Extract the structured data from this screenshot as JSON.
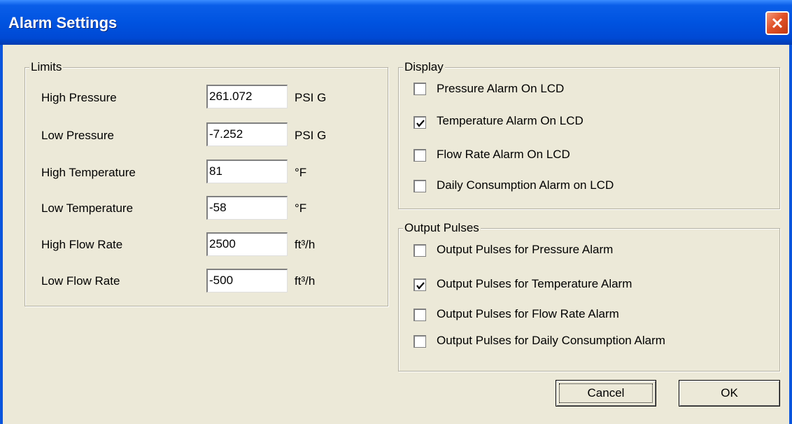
{
  "window": {
    "title": "Alarm Settings",
    "close_icon": "close-x-icon"
  },
  "limits": {
    "legend": "Limits",
    "rows": [
      {
        "label": "High Pressure",
        "value": "261.072",
        "unit": "PSI G"
      },
      {
        "label": "Low Pressure",
        "value": "-7.252",
        "unit": "PSI G"
      },
      {
        "label": "High Temperature",
        "value": "81",
        "unit": "°F"
      },
      {
        "label": "Low Temperature",
        "value": "-58",
        "unit": "°F"
      },
      {
        "label": "High Flow Rate",
        "value": "2500",
        "unit": "ft³/h"
      },
      {
        "label": "Low Flow Rate",
        "value": "-500",
        "unit": "ft³/h"
      }
    ]
  },
  "display": {
    "legend": "Display",
    "items": [
      {
        "label": "Pressure Alarm On LCD",
        "checked": false
      },
      {
        "label": "Temperature Alarm On LCD",
        "checked": true
      },
      {
        "label": "Flow Rate Alarm On LCD",
        "checked": false
      },
      {
        "label": "Daily Consumption Alarm on LCD",
        "checked": false
      }
    ]
  },
  "output_pulses": {
    "legend": "Output Pulses",
    "items": [
      {
        "label": "Output Pulses for Pressure Alarm",
        "checked": false
      },
      {
        "label": "Output Pulses for Temperature Alarm",
        "checked": true
      },
      {
        "label": "Output Pulses for Flow Rate Alarm",
        "checked": false
      },
      {
        "label": "Output Pulses for Daily Consumption Alarm",
        "checked": false
      }
    ]
  },
  "buttons": {
    "cancel": "Cancel",
    "ok": "OK"
  },
  "colors": {
    "titlebar": "#0053e0",
    "dialog_bg": "#ece9d8",
    "close_button": "#e2532a"
  }
}
